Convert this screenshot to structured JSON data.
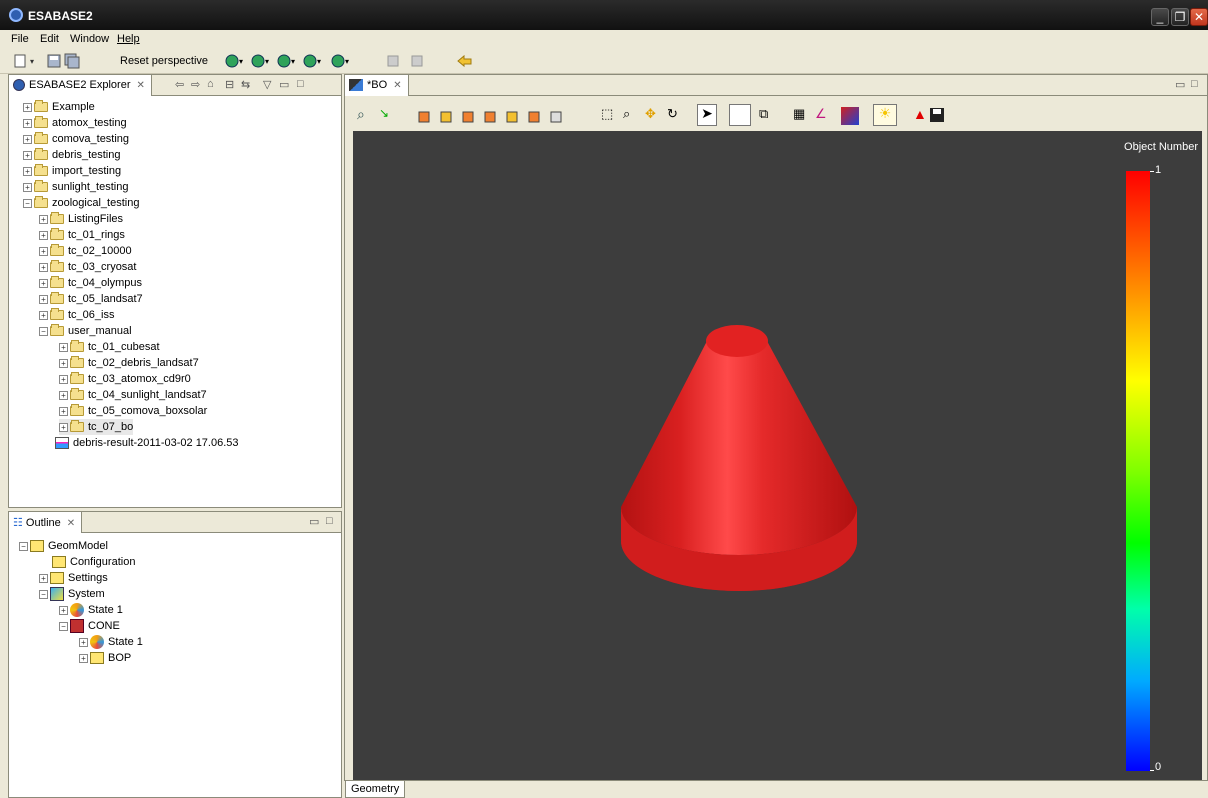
{
  "window": {
    "title": "ESABASE2"
  },
  "menu": [
    "File",
    "Edit",
    "Window",
    "Help"
  ],
  "toolbar": {
    "reset_perspective": "Reset perspective"
  },
  "explorer": {
    "tab_label": "ESABASE2 Explorer",
    "items": [
      "Example",
      "atomox_testing",
      "comova_testing",
      "debris_testing",
      "import_testing",
      "sunlight_testing",
      "zoological_testing",
      "ListingFiles",
      "tc_01_rings",
      "tc_02_10000",
      "tc_03_cryosat",
      "tc_04_olympus",
      "tc_05_landsat7",
      "tc_06_iss",
      "user_manual",
      "tc_01_cubesat",
      "tc_02_debris_landsat7",
      "tc_03_atomox_cd9r0",
      "tc_04_sunlight_landsat7",
      "tc_05_comova_boxsolar",
      "tc_07_bo",
      "debris-result-2011-03-02 17.06.53"
    ]
  },
  "outline": {
    "tab_label": "Outline",
    "items": [
      "GeomModel",
      "Configuration",
      "Settings",
      "System",
      "State 1",
      "CONE",
      "State 1",
      "BOP"
    ]
  },
  "editor": {
    "tab_label": "*BO",
    "bottom_tab": "Geometry",
    "legend_title": "Object Number",
    "legend_max": "1",
    "legend_min": "0",
    "cone_color": "#e02020"
  }
}
